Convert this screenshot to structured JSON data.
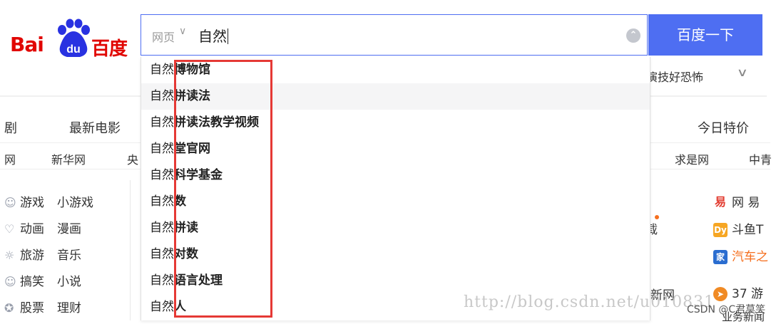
{
  "logo": {
    "bai": "Bai",
    "du": "du",
    "cn": "百度"
  },
  "search": {
    "scope": "网页",
    "query": "自然",
    "button": "百度一下"
  },
  "header": {
    "hot_snippet": "演技好恐怖"
  },
  "nav_row1": [
    "剧",
    "最新电影",
    "今日特价"
  ],
  "nav_row2": [
    "网",
    "新华网",
    "央",
    "求是网",
    "中青"
  ],
  "left_list": [
    {
      "icon": "game-icon",
      "a": "游戏",
      "b": "小游戏"
    },
    {
      "icon": "anime-icon",
      "a": "动画",
      "b": "漫画"
    },
    {
      "icon": "travel-icon",
      "a": "旅游",
      "b": "音乐"
    },
    {
      "icon": "smile-icon",
      "a": "搞笑",
      "b": "小说"
    },
    {
      "icon": "stock-icon",
      "a": "股票",
      "b": "理财"
    }
  ],
  "right_list": {
    "row1": "网 易",
    "row2": "斗鱼T",
    "row3": "汽车之",
    "row4": "37 游",
    "row5": "业务新闻",
    "side1": "载",
    "side4": "新网"
  },
  "suggestions": [
    {
      "typed": "自然",
      "rest": "博物馆"
    },
    {
      "typed": "自然",
      "rest": "拼读法"
    },
    {
      "typed": "自然",
      "rest": "拼读法教学视频"
    },
    {
      "typed": "自然",
      "rest": "堂官网"
    },
    {
      "typed": "自然",
      "rest": "科学基金"
    },
    {
      "typed": "自然",
      "rest": "数"
    },
    {
      "typed": "自然",
      "rest": "拼读"
    },
    {
      "typed": "自然",
      "rest": "对数"
    },
    {
      "typed": "自然",
      "rest": "语言处理"
    },
    {
      "typed": "自然",
      "rest": "人"
    }
  ],
  "watermark": {
    "url": "http://blog.csdn.net/u010831",
    "csdn": "CSDN @C君莫笑"
  },
  "colors": {
    "brand_red": "#e10602",
    "brand_blue": "#4e6ef2",
    "annotation_red": "#e53935"
  }
}
